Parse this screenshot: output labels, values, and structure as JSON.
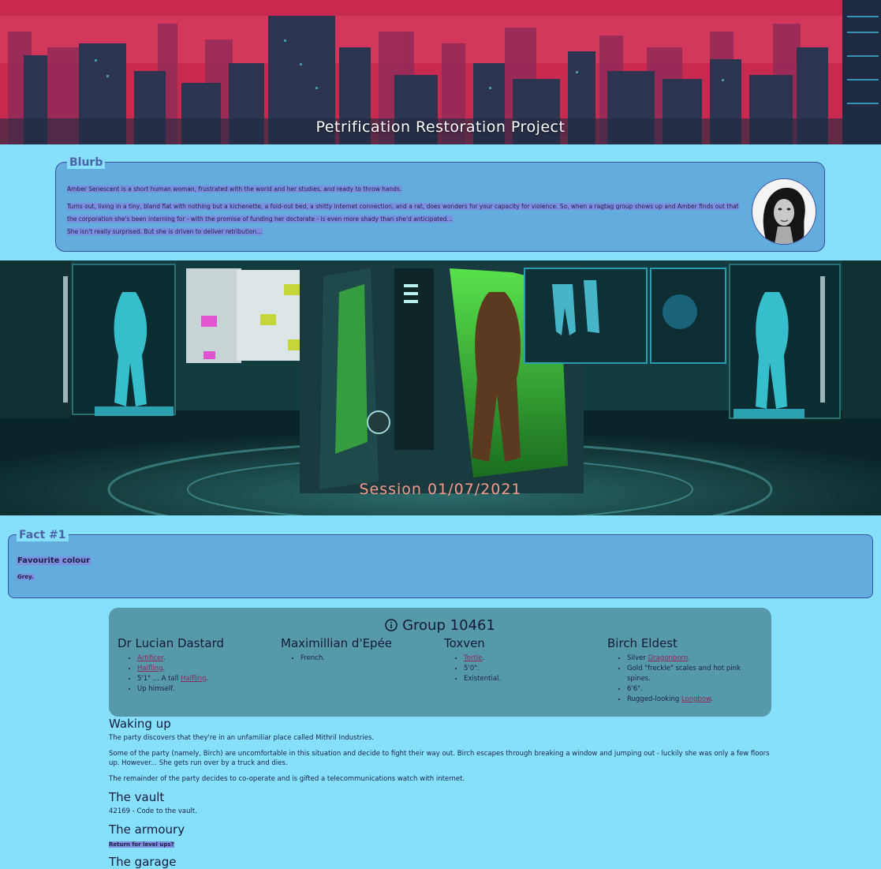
{
  "banner": {
    "title": "Petrification Restoration Project"
  },
  "blurb": {
    "legend": "Blurb",
    "paragraphs": [
      "Amber Senescent is a short human woman, frustrated with the world and her studies, and ready to throw hands.",
      "Turns out, living in a tiny, bland flat with nothing but a kichenette, a fold-out bed, a shitty internet connection, and a rat, does wonders for your capacity for violence. So, when a ragtag group shows up and Amber finds out that",
      "the corporation she's been interning for - with the promise of funding her doctorate - is even more shady than she'd anticipated...",
      "She isn't really surprised. But she is driven to deliver retribution..."
    ]
  },
  "session": {
    "title": "Session 01/07/2021"
  },
  "fact": {
    "legend": "Fact #1",
    "label": "Favourite colour",
    "value": "Grey."
  },
  "group": {
    "title": "Group 10461",
    "members": [
      {
        "name": "Dr Lucian Dastard",
        "items": [
          [
            {
              "link": "Artificer"
            },
            {
              "text": "."
            }
          ],
          [
            {
              "link": "Halfling"
            },
            {
              "text": "."
            }
          ],
          [
            {
              "text": "5'1\" ... A tall "
            },
            {
              "link": "Halfling"
            },
            {
              "text": "."
            }
          ],
          [
            {
              "text": "Up himself."
            }
          ]
        ]
      },
      {
        "name": "Maximillian d'Epée",
        "items": [
          [
            {
              "text": "French."
            }
          ]
        ]
      },
      {
        "name": "Toxven",
        "items": [
          [
            {
              "link": "Tortle"
            },
            {
              "text": "."
            }
          ],
          [
            {
              "text": "5'0\"."
            }
          ],
          [
            {
              "text": "Existential."
            }
          ]
        ]
      },
      {
        "name": "Birch Eldest",
        "items": [
          [
            {
              "text": "Silver "
            },
            {
              "link": "Dragonborn"
            },
            {
              "text": "."
            }
          ],
          [
            {
              "text": "Gold \"freckle\" scales and hot pink spines."
            }
          ],
          [
            {
              "text": "6'6\"."
            }
          ],
          [
            {
              "text": "Rugged-looking "
            },
            {
              "link": "Longbow"
            },
            {
              "text": "."
            }
          ]
        ]
      }
    ]
  },
  "log": {
    "waking": {
      "heading": "Waking up",
      "p1": "The party discovers that they're in an unfamiliar place called Mithril Industries.",
      "p2": "Some of the party (namely, Birch) are uncomfortable in this situation and decide to fight their way out. Birch escapes through breaking a window and jumping out - luckily she was only a few floors up. However... She gets run over by a truck and dies.",
      "p3": "The remainder of the party decides to co-operate and is gifted a telecommunications watch with internet."
    },
    "vault": {
      "heading": "The vault",
      "p1": "42169 - Code to the vault."
    },
    "armoury": {
      "heading": "The armoury",
      "p1": "Return for level ups?"
    },
    "garage": {
      "heading": "The garage"
    }
  },
  "colors": {
    "background": "#86e0fc",
    "panel": "#62acde",
    "group_panel": "#5699ab",
    "link": "#8a2a5a",
    "session_title": "#f79a8c"
  }
}
